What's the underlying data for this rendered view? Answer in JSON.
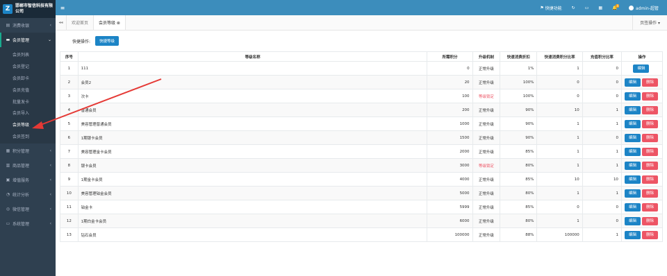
{
  "brand": {
    "name": "邯郸市智信科技有限公司"
  },
  "sidebar": {
    "items": [
      {
        "label": "消费收银",
        "icon": "cart-icon",
        "caret": "‹"
      },
      {
        "label": "会员管理",
        "icon": "card-icon",
        "caret": "⌄"
      },
      {
        "label": "积分管理",
        "icon": "grid-icon",
        "caret": "‹"
      },
      {
        "label": "商品管理",
        "icon": "table-icon",
        "caret": "‹"
      },
      {
        "label": "增值服务",
        "icon": "server-icon",
        "caret": "‹"
      },
      {
        "label": "统计分析",
        "icon": "chart-icon",
        "caret": "‹"
      },
      {
        "label": "微信管理",
        "icon": "wechat-icon",
        "caret": "‹"
      },
      {
        "label": "系统管理",
        "icon": "monitor-icon",
        "caret": "‹"
      }
    ],
    "submenu": [
      "会员列表",
      "会员登记",
      "会员卸卡",
      "会员充值",
      "批量发卡",
      "会员导入",
      "会员等级",
      "会员签到"
    ]
  },
  "topbar": {
    "toggle": "≡",
    "quick_func": "快捷功能",
    "badge": "4",
    "user": "admin-超管"
  },
  "tabs": {
    "prev": "◂◂",
    "items": [
      "欢迎首页",
      "会员等级 ⊗"
    ],
    "page_ops": "页签操作 ▾"
  },
  "quick": {
    "label": "快捷操作:",
    "button": "快捷等级"
  },
  "table": {
    "headers": [
      "序号",
      "等级名称",
      "所需积分",
      "升级机制",
      "快速消费折扣",
      "快速消费积分比率",
      "充值积分比率",
      "操作"
    ],
    "edit_label": "编辑",
    "delete_label": "删除",
    "rows": [
      [
        "1",
        "111",
        "0",
        "正常升级",
        "1%",
        "1",
        "0"
      ],
      [
        "2",
        "会员2",
        "20",
        "正常升级",
        "100%",
        "0",
        "0"
      ],
      [
        "3",
        "次卡",
        "100",
        "等级锁定",
        "100%",
        "0",
        "0"
      ],
      [
        "4",
        "普通会员",
        "200",
        "正常升级",
        "90%",
        "10",
        "1"
      ],
      [
        "5",
        "美容管理普通会员",
        "1000",
        "正常升级",
        "90%",
        "1",
        "1"
      ],
      [
        "6",
        "1期银卡会员",
        "1500",
        "正常升级",
        "90%",
        "1",
        "0"
      ],
      [
        "7",
        "美容管理金卡会员",
        "2000",
        "正常升级",
        "85%",
        "1",
        "1"
      ],
      [
        "8",
        "银卡会员",
        "3000",
        "等级锁定",
        "80%",
        "1",
        "1"
      ],
      [
        "9",
        "1期金卡会员",
        "4000",
        "正常升级",
        "85%",
        "10",
        "10"
      ],
      [
        "10",
        "美容管理铂金会员",
        "5000",
        "正常升级",
        "80%",
        "1",
        "1"
      ],
      [
        "11",
        "铂金卡",
        "5999",
        "正常升级",
        "85%",
        "0",
        "0"
      ],
      [
        "12",
        "1期白金卡会员",
        "6000",
        "正常升级",
        "80%",
        "1",
        "0"
      ],
      [
        "13",
        "钻石会员",
        "100000",
        "正常升级",
        "88%",
        "100000",
        "1"
      ]
    ]
  },
  "colors": {
    "sidebar": "#2f4050",
    "topbar": "#3c8dbc",
    "primary": "#1c84c6",
    "danger": "#ed5565",
    "arrow": "#e53935"
  }
}
